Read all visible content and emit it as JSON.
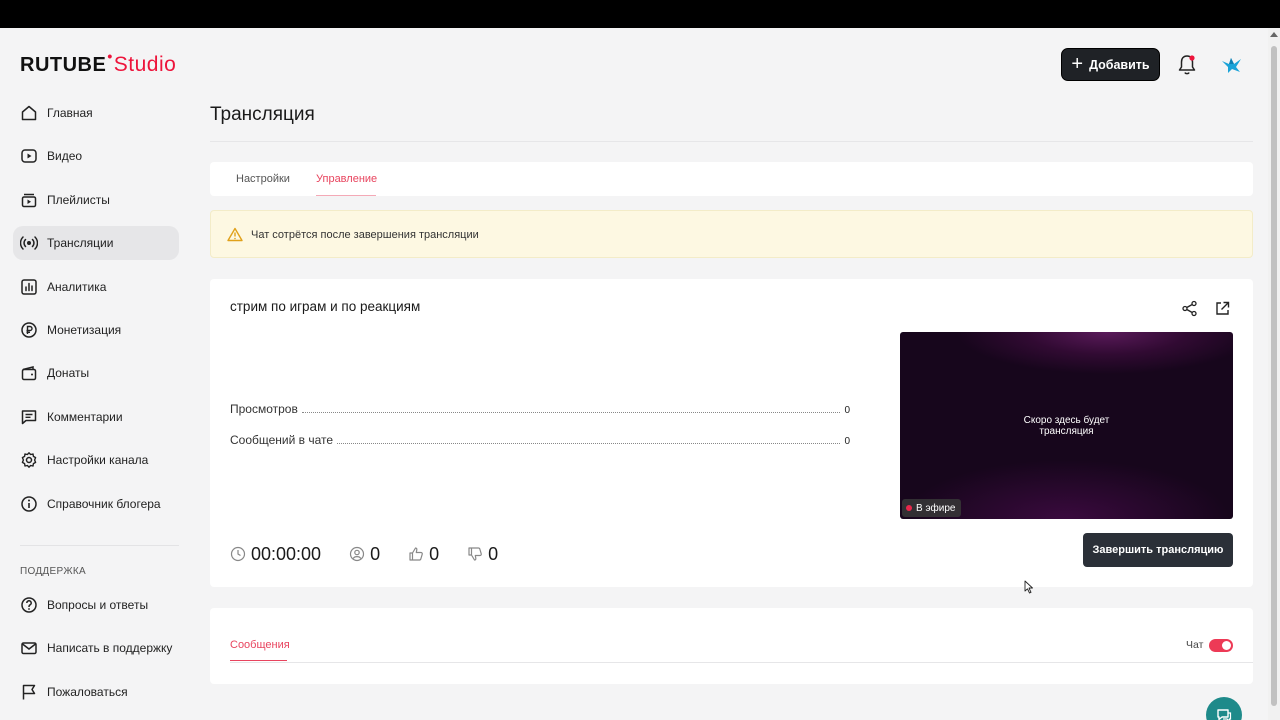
{
  "header": {
    "logo_main": "RUTUBE",
    "logo_sub": "Studio",
    "add_label": "Добавить"
  },
  "sidebar": {
    "items": [
      {
        "label": "Главная",
        "icon": "home-icon"
      },
      {
        "label": "Видео",
        "icon": "video-icon"
      },
      {
        "label": "Плейлисты",
        "icon": "playlist-icon"
      },
      {
        "label": "Трансляции",
        "icon": "broadcast-icon",
        "active": true
      },
      {
        "label": "Аналитика",
        "icon": "analytics-icon"
      },
      {
        "label": "Монетизация",
        "icon": "ruble-icon"
      },
      {
        "label": "Донаты",
        "icon": "wallet-icon"
      },
      {
        "label": "Комментарии",
        "icon": "comment-icon"
      },
      {
        "label": "Настройки канала",
        "icon": "gear-icon"
      },
      {
        "label": "Справочник блогера",
        "icon": "info-icon"
      }
    ],
    "support_title": "ПОДДЕРЖКА",
    "support_items": [
      {
        "label": "Вопросы и ответы",
        "icon": "question-icon"
      },
      {
        "label": "Написать в поддержку",
        "icon": "mail-icon"
      },
      {
        "label": "Пожаловаться",
        "icon": "flag-icon"
      }
    ]
  },
  "page": {
    "title": "Трансляция",
    "tabs": [
      {
        "label": "Настройки"
      },
      {
        "label": "Управление",
        "active": true
      }
    ],
    "warning": "Чат сотрётся после завершения трансляции"
  },
  "stream": {
    "name": "стрим по играм и по реакциям",
    "stats": [
      {
        "label": "Просмотров",
        "value": "0"
      },
      {
        "label": "Сообщений в чате",
        "value": "0"
      }
    ],
    "preview_text": "Скоро здесь будет трансляция",
    "live_label": "В эфире",
    "metrics": {
      "duration": "00:00:00",
      "viewers": "0",
      "likes": "0",
      "dislikes": "0"
    },
    "end_label": "Завершить трансляцию"
  },
  "chat": {
    "tab_label": "Сообщения",
    "toggle_label": "Чат",
    "toggle_on": true
  },
  "colors": {
    "accent": "#ed143b",
    "tab_active": "#e8445e",
    "button_dark": "#1f2226",
    "warning_bg": "#fdf8e2"
  }
}
